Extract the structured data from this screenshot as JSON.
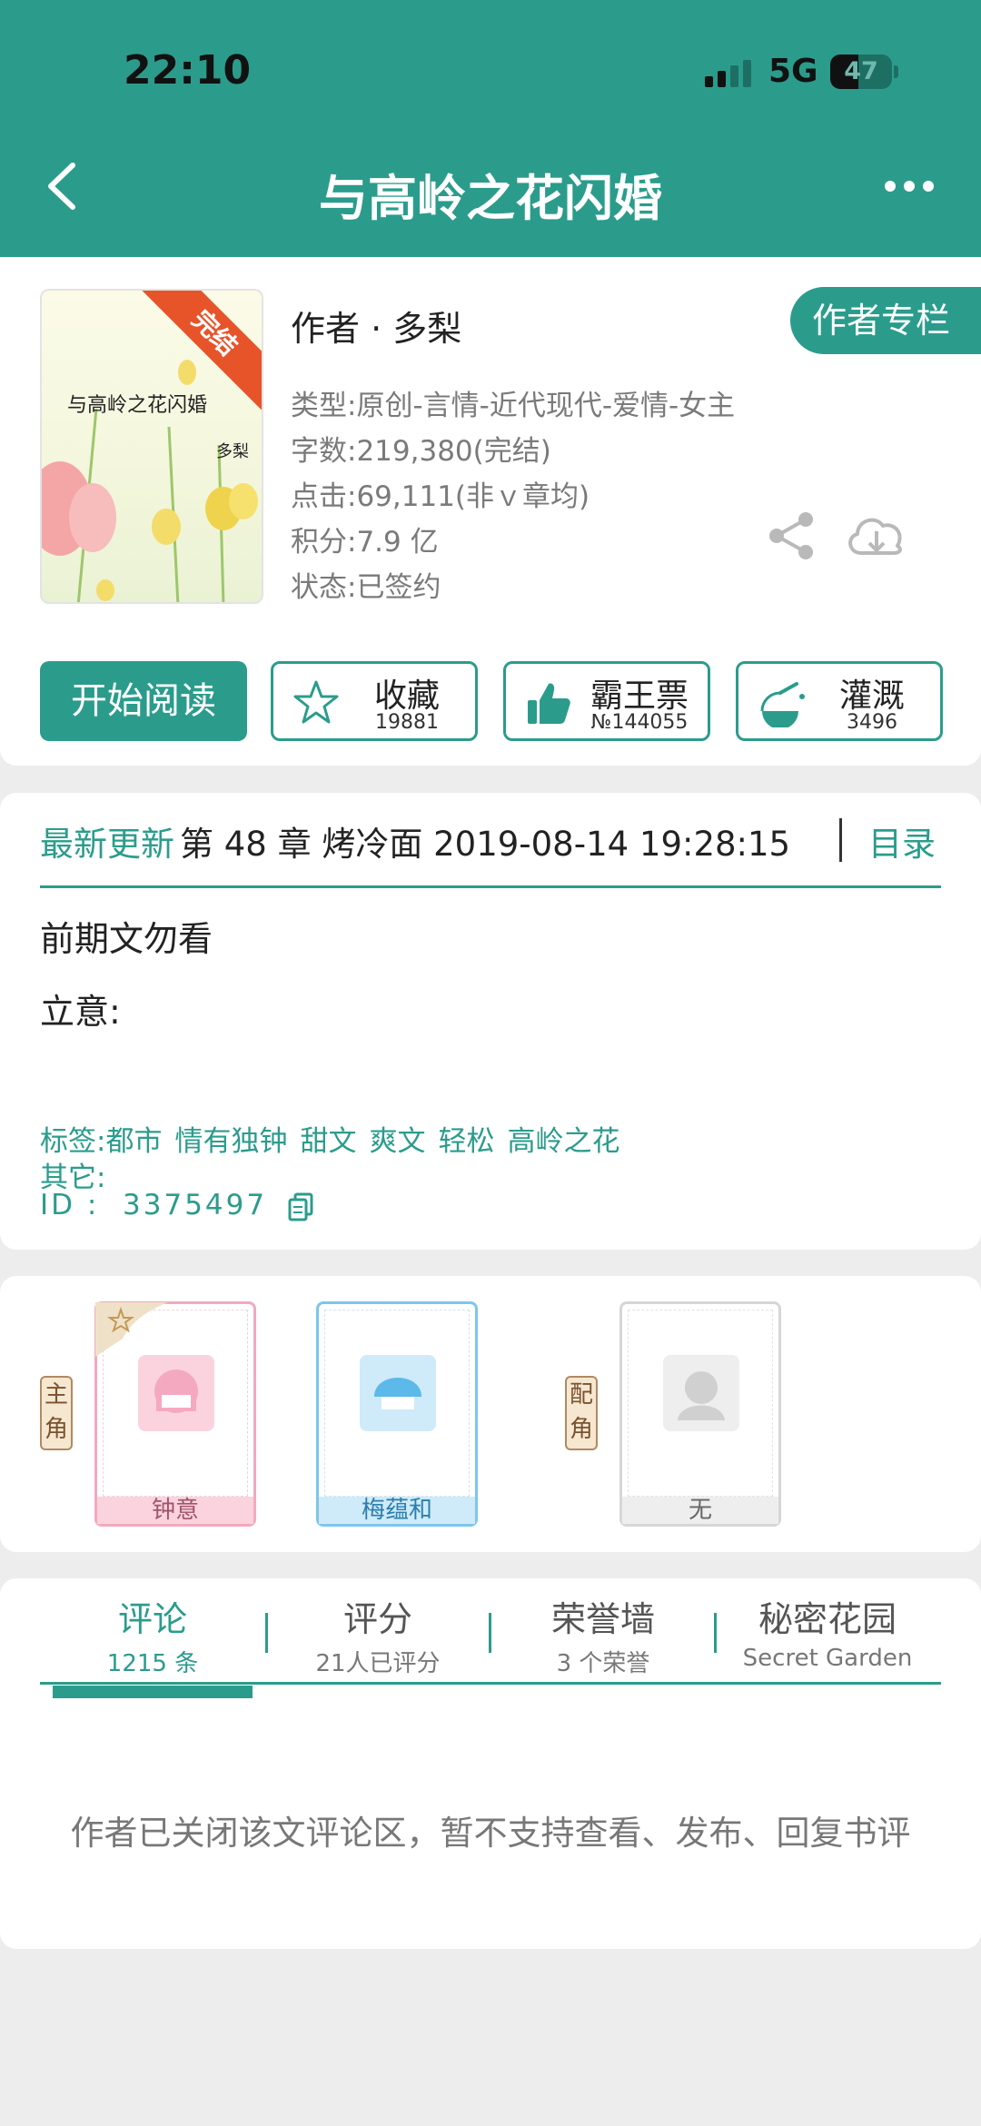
{
  "status_bar": {
    "time": "22:10",
    "network": "5G",
    "battery": "47"
  },
  "header": {
    "title": "与高岭之花闪婚"
  },
  "book": {
    "cover_title": "与高岭之花闪婚",
    "cover_author": "多梨",
    "cover_ribbon": "完结",
    "author_line": "作者 · 多梨",
    "author_column_button": "作者专栏",
    "type": "类型:原创-言情-近代现代-爱情-女主",
    "word_count": "字数:219,380(完结)",
    "clicks": "点击:69,111(非ｖ章均)",
    "score": "积分:7.9 亿",
    "status": "状态:已签约"
  },
  "actions": {
    "read": "开始阅读",
    "favorite": {
      "label": "收藏",
      "count": "19881"
    },
    "ticket": {
      "label": "霸王票",
      "count": "№144055"
    },
    "water": {
      "label": "灌溉",
      "count": "3496"
    }
  },
  "update": {
    "latest_label": "最新更新",
    "latest_text": "第 48 章 烤冷面 2019-08-14 19:28:15",
    "toc": "目录",
    "summary_line1": "前期文勿看",
    "summary_line2": "立意:",
    "tags_label": "标签:",
    "tags": [
      "都市",
      "情有独钟",
      "甜文",
      "爽文",
      "轻松",
      "高岭之花"
    ],
    "other_label": "其它:",
    "id_label": "ID   :",
    "id_value": "3375497"
  },
  "characters": {
    "main_badge": "主角",
    "supporting_badge": "配角",
    "main": [
      {
        "name": "钟意",
        "color": "#f5a9c0"
      },
      {
        "name": "梅蕴和",
        "color": "#7cc6ee"
      }
    ],
    "supporting": [
      {
        "name": "无",
        "color": "#d0d0d0"
      }
    ]
  },
  "tabs": [
    {
      "label": "评论",
      "sub": "1215 条"
    },
    {
      "label": "评分",
      "sub": "21人已评分"
    },
    {
      "label": "荣誉墙",
      "sub": "3 个荣誉"
    },
    {
      "label": "秘密花园",
      "sub": "Secret Garden"
    }
  ],
  "comments_closed_message": "作者已关闭该文评论区，暂不支持查看、发布、回复书评",
  "colors": {
    "accent": "#2b9c8c",
    "ribbon": "#e7542a"
  }
}
